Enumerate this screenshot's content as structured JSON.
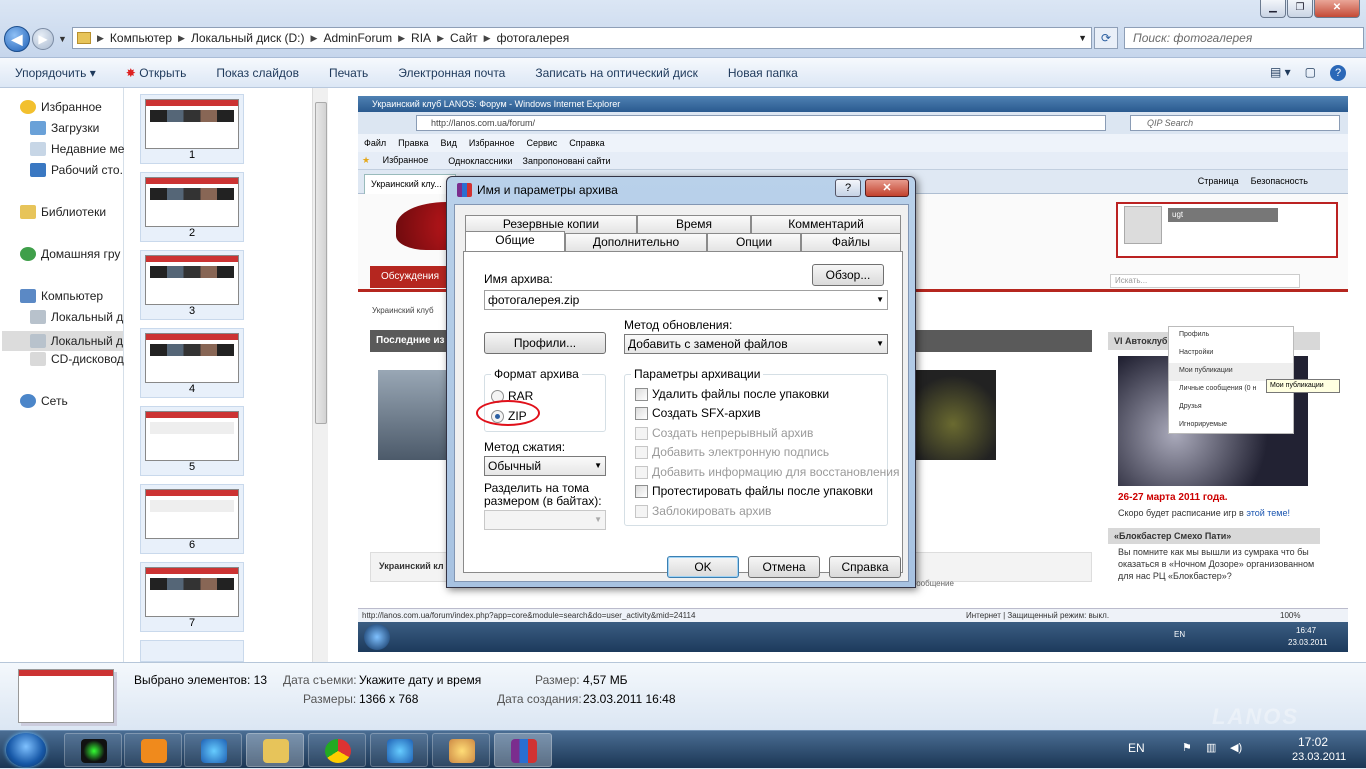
{
  "explorer": {
    "breadcrumb": [
      "Компьютер",
      "Локальный диск (D:)",
      "AdminForum",
      "RIA",
      "Сайт",
      "фотогалерея"
    ],
    "search_placeholder": "Поиск: фотогалерея",
    "commands": [
      "Упорядочить",
      "Открыть",
      "Показ слайдов",
      "Печать",
      "Электронная почта",
      "Записать на оптический диск",
      "Новая папка"
    ],
    "nav": {
      "favorites": "Избранное",
      "downloads": "Загрузки",
      "recent": "Недавние ме",
      "desktop": "Рабочий сто.",
      "libraries": "Библиотеки",
      "homegroup": "Домашняя гру",
      "computer": "Компьютер",
      "disk1": "Локальный д",
      "disk2": "Локальный д",
      "cd": "CD-дисковод",
      "network": "Сеть"
    },
    "thumbs": [
      "1",
      "2",
      "3",
      "4",
      "5",
      "6",
      "7"
    ]
  },
  "ie": {
    "title": "Украинский клуб LANOS: Форум - Windows Internet Explorer",
    "url": "http://lanos.com.ua/forum/",
    "search_placeholder": "QIP Search",
    "menu": [
      "Файл",
      "Правка",
      "Вид",
      "Избранное",
      "Сервис",
      "Справка"
    ],
    "favorites": [
      "Избранное",
      "Одноклассники",
      "Запропоновані сайти"
    ],
    "tab": "Украинский клу...",
    "tab_cmds": [
      "Страница",
      "Безопасность"
    ],
    "site_tab": "Обсуждения",
    "crumb": "Украинский клуб",
    "latest": "Последние из",
    "user": "ugt",
    "search_site": "Искать...",
    "dropdown": [
      "Профиль",
      "Настройки",
      "Мои публикации",
      "Личные сообщения (0 н",
      "Друзья",
      "Игнорируемые"
    ],
    "tooltip": "Мои публикации",
    "vi_title": "VI Автоклубный турнир по волейболу",
    "vi_date": "26-27 марта 2011 года.",
    "vi_text_a": "Скоро будет расписание игр в ",
    "vi_link": "этой теме!",
    "bb_title": "«Блокбастер Смехо Пати»",
    "bb_text": "Вы помните как мы вышли из сумрака что бы оказаться в «Ночном Дозоре» организованном для нас РЦ «Блокбастер»?",
    "forum_head": "Украинский кл",
    "forum_msg": "ее сообщение",
    "status_url": "http://lanos.com.ua/forum/index.php?app=core&module=search&do=user_activity&mid=24114",
    "status_zone": "Интернет | Защищенный режим: выкл.",
    "zoom": "100%",
    "lang": "EN",
    "time": "16:47",
    "date": "23.03.2011"
  },
  "dialog": {
    "title": "Имя и параметры архива",
    "help_btn": "?",
    "close_btn": "✕",
    "tabs_top": [
      "Резервные копии",
      "Время",
      "Комментарий"
    ],
    "tabs_bottom": [
      "Общие",
      "Дополнительно",
      "Опции",
      "Файлы"
    ],
    "archive_name_label": "Имя архива:",
    "archive_name": "фотогалерея.zip",
    "browse": "Обзор...",
    "profiles": "Профили...",
    "update_label": "Метод обновления:",
    "update_value": "Добавить с заменой файлов",
    "format_title": "Формат архива",
    "format_rar": "RAR",
    "format_zip": "ZIP",
    "compression_label": "Метод сжатия:",
    "compression_value": "Обычный",
    "split_label": "Разделить на тома размером (в байтах):",
    "params_title": "Параметры архивации",
    "options": [
      {
        "label": "Удалить файлы после упаковки",
        "enabled": true
      },
      {
        "label": "Создать SFX-архив",
        "enabled": true
      },
      {
        "label": "Создать непрерывный архив",
        "enabled": false
      },
      {
        "label": "Добавить электронную подпись",
        "enabled": false
      },
      {
        "label": "Добавить информацию для восстановления",
        "enabled": false
      },
      {
        "label": "Протестировать файлы после упаковки",
        "enabled": true
      },
      {
        "label": "Заблокировать архив",
        "enabled": false
      }
    ],
    "ok": "OK",
    "cancel": "Отмена",
    "help": "Справка"
  },
  "details": {
    "selected": "Выбрано элементов: 13",
    "date_label": "Дата съемки:",
    "date_value": "Укажите дату и время",
    "size_label": "Размер:",
    "size_value": "4,57 МБ",
    "dims_label": "Размеры:",
    "dims_value": "1366 x 768",
    "created_label": "Дата создания:",
    "created_value": "23.03.2011 16:48"
  },
  "taskbar": {
    "lang": "EN",
    "time": "17:02",
    "date": "23.03.2011"
  },
  "watermark": "LANOS"
}
